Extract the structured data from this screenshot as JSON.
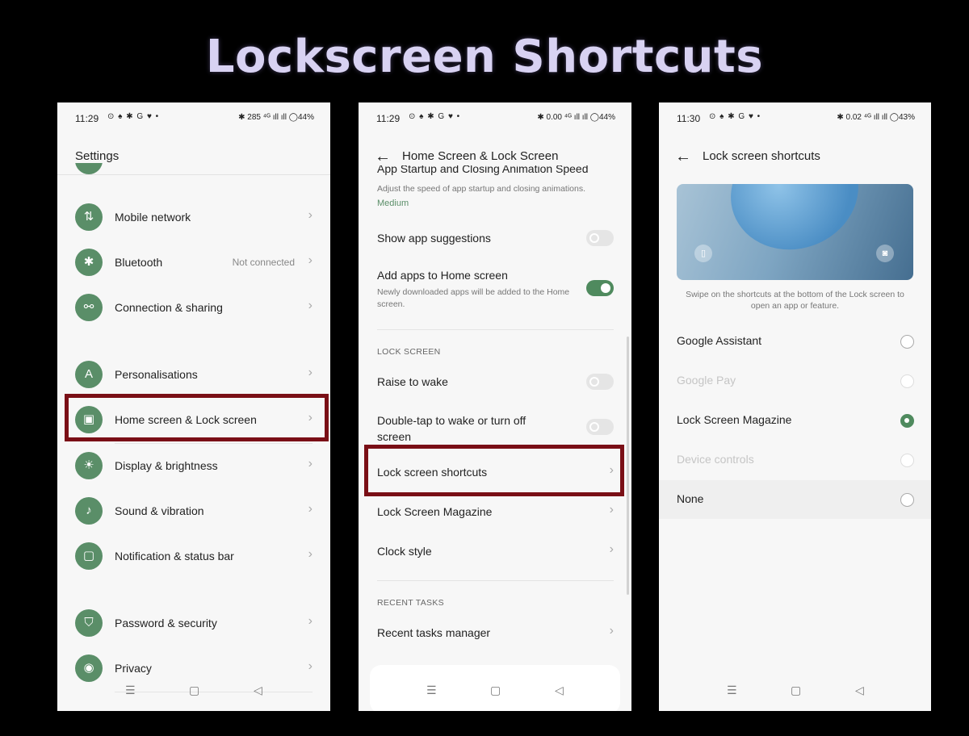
{
  "title": "Lockscreen Shortcuts",
  "phone1": {
    "status": {
      "time": "11:29",
      "left_icons": "⊙ ♠ ✱ G ♥ •",
      "right_icons": "✱ 285 ⁴ᴳ ıll ıll ◯44%"
    },
    "appbar_title": "Settings",
    "items": [
      {
        "label": "Mobile network",
        "value": "",
        "icon": "mobile-network-icon",
        "glyph": "⇅"
      },
      {
        "label": "Bluetooth",
        "value": "Not connected",
        "icon": "bluetooth-icon",
        "glyph": "✱"
      },
      {
        "label": "Connection & sharing",
        "value": "",
        "icon": "connection-sharing-icon",
        "glyph": "⚯"
      },
      {
        "label": "Personalisations",
        "value": "",
        "icon": "personalisation-icon",
        "glyph": "A"
      },
      {
        "label": "Home screen & Lock screen",
        "value": "",
        "icon": "home-lock-screen-icon",
        "glyph": "▣"
      },
      {
        "label": "Display & brightness",
        "value": "",
        "icon": "brightness-icon",
        "glyph": "☀"
      },
      {
        "label": "Sound & vibration",
        "value": "",
        "icon": "bell-icon",
        "glyph": "♪"
      },
      {
        "label": "Notification & status bar",
        "value": "",
        "icon": "notification-icon",
        "glyph": "▢"
      },
      {
        "label": "Password & security",
        "value": "",
        "icon": "shield-icon",
        "glyph": "⛉"
      },
      {
        "label": "Privacy",
        "value": "",
        "icon": "privacy-eye-icon",
        "glyph": "◉"
      }
    ]
  },
  "phone2": {
    "status": {
      "time": "11:29",
      "left_icons": "⊙ ♠ ✱ G ♥ •",
      "right_icons": "✱ 0.00 ⁴ᴳ ıll ıll ◯44%"
    },
    "appbar_title": "Home Screen & Lock Screen",
    "partial_title": "App Startup and Closing Animation Speed",
    "anim_desc": "Adjust the speed of app startup and closing animations.",
    "anim_value": "Medium",
    "show_suggestions": "Show app suggestions",
    "add_apps": "Add apps to Home screen",
    "add_apps_desc": "Newly downloaded apps will be added to the Home screen.",
    "lock_section": "LOCK SCREEN",
    "raise_wake": "Raise to wake",
    "double_tap": "Double-tap to wake or turn off screen",
    "lock_shortcuts": "Lock screen shortcuts",
    "lock_magazine": "Lock Screen Magazine",
    "clock_style": "Clock style",
    "recent_section": "RECENT TASKS",
    "recent_manager": "Recent tasks manager",
    "toggles": {
      "show_suggestions": false,
      "add_apps": true,
      "raise_wake": false,
      "double_tap": false
    }
  },
  "phone3": {
    "status": {
      "time": "11:30",
      "left_icons": "⊙ ♠ ✱ G ♥ •",
      "right_icons": "✱ 0.02 ⁴ᴳ ıll ıll ◯43%"
    },
    "appbar_title": "Lock screen shortcuts",
    "caption": "Swipe on the shortcuts at the bottom of the Lock screen to open an app or feature.",
    "options": [
      {
        "label": "Google Assistant",
        "checked": false,
        "disabled": false
      },
      {
        "label": "Google Pay",
        "checked": false,
        "disabled": true
      },
      {
        "label": "Lock Screen Magazine",
        "checked": true,
        "disabled": false
      },
      {
        "label": "Device controls",
        "checked": false,
        "disabled": true
      },
      {
        "label": "None",
        "checked": false,
        "disabled": false
      }
    ]
  },
  "nav": {
    "menu": "☰",
    "home": "▢",
    "back": "◁"
  },
  "colors": {
    "accent": "#5a8e68",
    "highlight": "#7a0f16",
    "title": "#d8d2f2"
  }
}
